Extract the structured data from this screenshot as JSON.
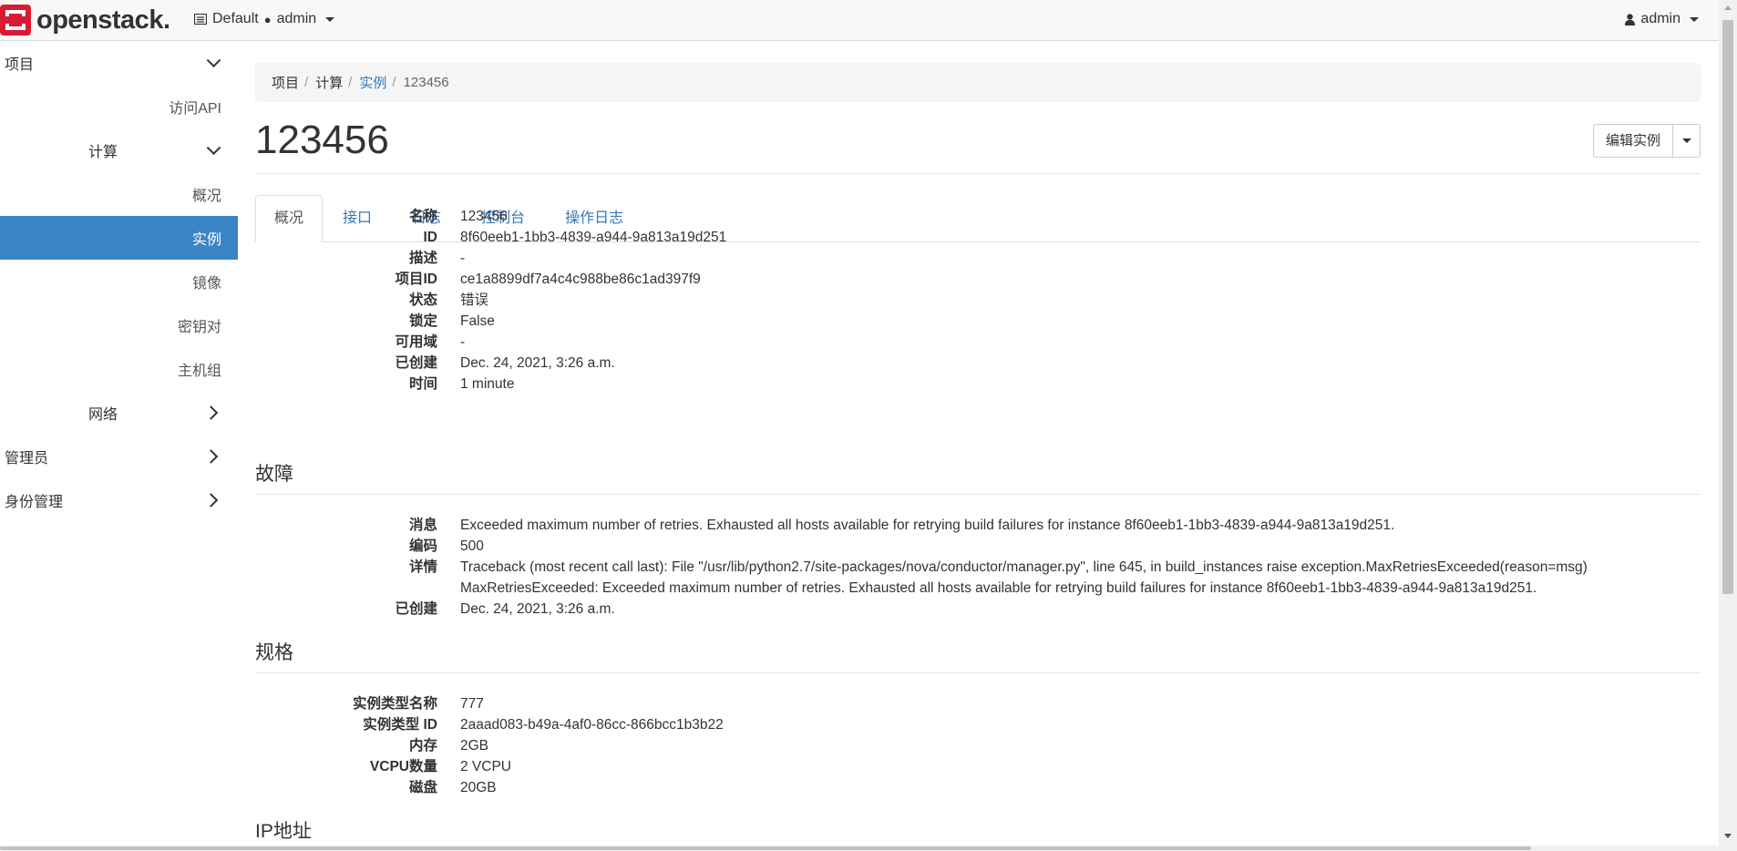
{
  "navbar": {
    "brand": "openstack",
    "brand_dot": ".",
    "domain": "Default",
    "project_sep": "●",
    "project": "admin",
    "user": "admin"
  },
  "sidebar": {
    "project": "项目",
    "api_access": "访问API",
    "compute": "计算",
    "overview": "概况",
    "instances": "实例",
    "images": "镜像",
    "key_pairs": "密钥对",
    "server_groups": "主机组",
    "network": "网络",
    "admin": "管理员",
    "identity": "身份管理"
  },
  "breadcrumb": {
    "project": "项目",
    "compute": "计算",
    "instances": "实例",
    "current": "123456",
    "separator": "/"
  },
  "page": {
    "title": "123456",
    "edit_button": "编辑实例"
  },
  "tabs": {
    "overview": "概况",
    "interfaces": "接口",
    "log": "日志",
    "console": "控制台",
    "action_log": "操作日志"
  },
  "overview": {
    "name_label": "名称",
    "name": "123456",
    "id_label": "ID",
    "id": "8f60eeb1-1bb3-4839-a944-9a813a19d251",
    "desc_label": "描述",
    "desc": "-",
    "project_id_label": "项目ID",
    "project_id": "ce1a8899df7a4c4c988be86c1ad397f9",
    "status_label": "状态",
    "status": "错误",
    "locked_label": "锁定",
    "locked": "False",
    "az_label": "可用域",
    "az": "-",
    "created_label": "已创建",
    "created": "Dec. 24, 2021, 3:26 a.m.",
    "age_label": "时间",
    "age": "1 minute"
  },
  "fault": {
    "title": "故障",
    "message_label": "消息",
    "message": "Exceeded maximum number of retries. Exhausted all hosts available for retrying build failures for instance 8f60eeb1-1bb3-4839-a944-9a813a19d251.",
    "code_label": "编码",
    "code": "500",
    "details_label": "详情",
    "details_line1": "Traceback (most recent call last): File \"/usr/lib/python2.7/site-packages/nova/conductor/manager.py\", line 645, in build_instances raise exception.MaxRetriesExceeded(reason=msg)",
    "details_line2": "MaxRetriesExceeded: Exceeded maximum number of retries. Exhausted all hosts available for retrying build failures for instance 8f60eeb1-1bb3-4839-a944-9a813a19d251.",
    "created_label": "已创建",
    "created": "Dec. 24, 2021, 3:26 a.m."
  },
  "specs": {
    "title": "规格",
    "flavor_name_label": "实例类型名称",
    "flavor_name": "777",
    "flavor_id_label": "实例类型 ID",
    "flavor_id": "2aaad083-b49a-4af0-86cc-866bcc1b3b22",
    "ram_label": "内存",
    "ram": "2GB",
    "vcpus_label": "VCPU数量",
    "vcpus": "2 VCPU",
    "disk_label": "磁盘",
    "disk": "20GB"
  },
  "ip": {
    "title": "IP地址"
  },
  "colors": {
    "accent": "#3b84c6",
    "link": "#337ab7",
    "brand_red": "#da1a32"
  },
  "icons": {
    "logo": "openstack-logo-icon",
    "project_menu": "project-list-icon",
    "user": "user-icon"
  }
}
